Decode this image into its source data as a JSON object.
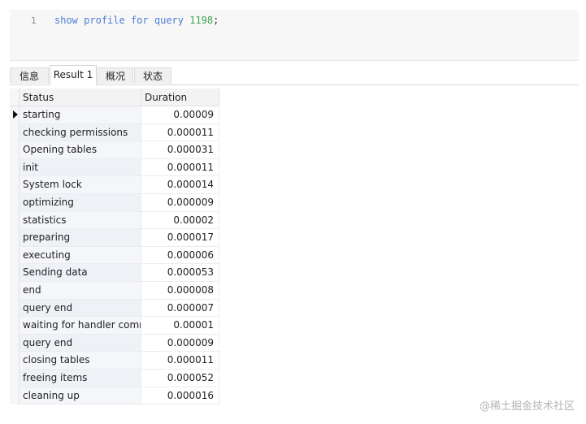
{
  "editor": {
    "line_number": "1",
    "code": {
      "kw1": "show",
      "kw2": "profile",
      "kw3": "for",
      "kw4": "query",
      "number": "1198",
      "terminator": ";"
    }
  },
  "tabs": [
    {
      "label": "信息",
      "active": false
    },
    {
      "label": "Result 1",
      "active": true
    },
    {
      "label": "概况",
      "active": false
    },
    {
      "label": "状态",
      "active": false
    }
  ],
  "table": {
    "headers": [
      "Status",
      "Duration"
    ],
    "rows": [
      {
        "status": "starting",
        "duration": "0.00009"
      },
      {
        "status": "checking permissions",
        "duration": "0.000011"
      },
      {
        "status": "Opening tables",
        "duration": "0.000031"
      },
      {
        "status": "init",
        "duration": "0.000011"
      },
      {
        "status": "System lock",
        "duration": "0.000014"
      },
      {
        "status": "optimizing",
        "duration": "0.000009"
      },
      {
        "status": "statistics",
        "duration": "0.00002"
      },
      {
        "status": "preparing",
        "duration": "0.000017"
      },
      {
        "status": "executing",
        "duration": "0.000006"
      },
      {
        "status": "Sending data",
        "duration": "0.000053"
      },
      {
        "status": "end",
        "duration": "0.000008"
      },
      {
        "status": "query end",
        "duration": "0.000007"
      },
      {
        "status": "waiting for handler comm",
        "duration": "0.00001"
      },
      {
        "status": "query end",
        "duration": "0.000009"
      },
      {
        "status": "closing tables",
        "duration": "0.000011"
      },
      {
        "status": "freeing items",
        "duration": "0.000052"
      },
      {
        "status": "cleaning up",
        "duration": "0.000016"
      }
    ]
  },
  "watermark": "@稀土掘金技术社区",
  "colors": {
    "keyword": "#4a7cd8",
    "number": "#3fa64a"
  }
}
